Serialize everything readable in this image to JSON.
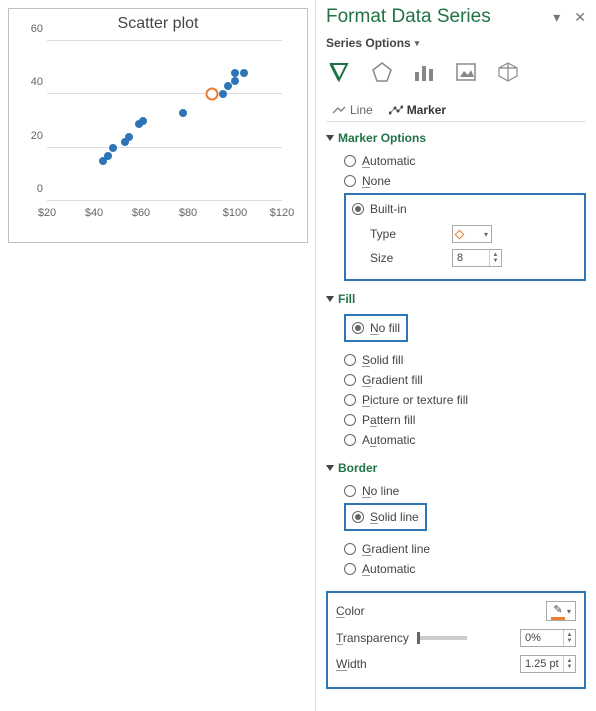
{
  "chart_data": {
    "type": "scatter",
    "title": "Scatter plot",
    "xlabel": "",
    "ylabel": "",
    "xlim": [
      20,
      120
    ],
    "ylim": [
      0,
      60
    ],
    "x_ticks": [
      "$20",
      "$40",
      "$60",
      "$80",
      "$100",
      "$120"
    ],
    "y_ticks": [
      0,
      20,
      40,
      60
    ],
    "x": [
      44,
      46,
      48,
      53,
      55,
      59,
      61,
      78,
      90,
      95,
      97,
      100,
      100,
      104
    ],
    "y": [
      15,
      17,
      20,
      22,
      24,
      29,
      30,
      33,
      40,
      40,
      43,
      45,
      48,
      48
    ],
    "highlight_point": {
      "x": 90,
      "y": 40
    },
    "colors": {
      "normal": "#2E75B6",
      "highlight": "#ED7D31"
    }
  },
  "panel": {
    "title": "Format Data Series",
    "subtitle": "Series Options",
    "tabs": {
      "line": "Line",
      "marker": "Marker"
    },
    "marker_options": {
      "title": "Marker Options",
      "automatic": "Automatic",
      "none": "None",
      "builtin": "Built-in",
      "type_label": "Type",
      "size_label": "Size",
      "size_value": "8"
    },
    "fill": {
      "title": "Fill",
      "no_fill": "No fill",
      "solid": "Solid fill",
      "gradient": "Gradient fill",
      "picture": "Picture or texture fill",
      "pattern": "Pattern fill",
      "automatic": "Automatic"
    },
    "border": {
      "title": "Border",
      "no_line": "No line",
      "solid": "Solid line",
      "gradient": "Gradient line",
      "automatic": "Automatic"
    },
    "props": {
      "color": "Color",
      "transparency": "Transparency",
      "trans_value": "0%",
      "width": "Width",
      "width_value": "1.25 pt"
    }
  }
}
